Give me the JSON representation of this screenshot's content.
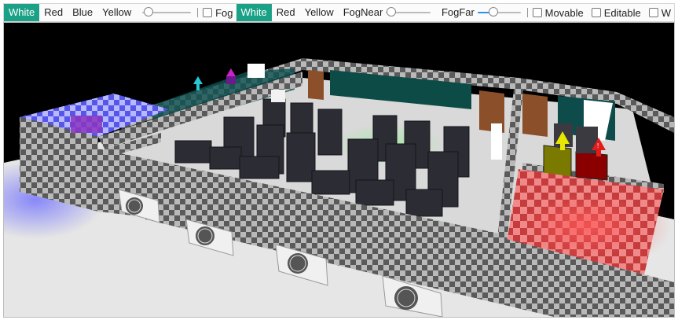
{
  "toolbar": {
    "light_group": {
      "white": "White",
      "red": "Red",
      "blue": "Blue",
      "yellow": "Yellow"
    },
    "light_intensity_slider": 0.25,
    "fog": {
      "label": "Fog",
      "checked": false
    },
    "fog_color_group": {
      "white": "White",
      "red": "Red",
      "yellow": "Yellow"
    },
    "fog_near": {
      "label": "FogNear",
      "value": 0.0
    },
    "fog_far": {
      "label": "FogFar",
      "value": 0.35
    },
    "movable": {
      "label": "Movable",
      "checked": false
    },
    "editable": {
      "label": "Editable",
      "checked": false
    },
    "truncated_checkbox": {
      "label": "W",
      "checked": false
    },
    "active_color": "#1aa186"
  },
  "scene": {
    "background": "#000000",
    "floor_color": "#e8e8e8",
    "wall_pattern": "checkerboard",
    "light_colors": {
      "blue": "#5b5bff",
      "red": "#ff3b3b",
      "yellow": "#e6e600",
      "green": "#8fd08f"
    },
    "markers": [
      {
        "color": "#27c7d6",
        "icon": "arrow-up-icon"
      },
      {
        "color": "#c822c8",
        "icon": "arrow-up-icon"
      },
      {
        "color": "#e6e600",
        "icon": "arrow-up-icon"
      },
      {
        "color": "#e21b1b",
        "icon": "alert-arrow-icon"
      }
    ]
  }
}
